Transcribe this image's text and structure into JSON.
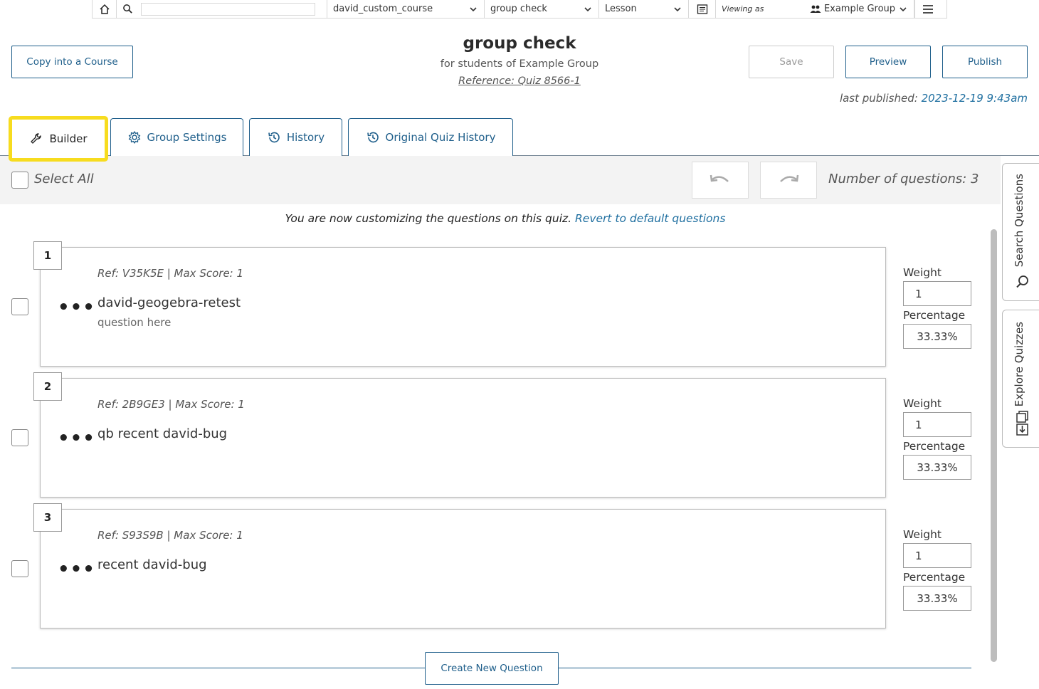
{
  "topbar": {
    "search_placeholder": "",
    "course": "david_custom_course",
    "lesson": "group check",
    "type": "Lesson",
    "viewing_as": "Viewing as",
    "group": "Example Group"
  },
  "header": {
    "title": "group check",
    "subtitle": "for students of Example Group",
    "reference": "Reference: Quiz 8566-1",
    "copy_label": "Copy into a Course",
    "save_label": "Save",
    "preview_label": "Preview",
    "publish_label": "Publish",
    "last_published_label": "last published:",
    "last_published_date": "2023-12-19 9:43am"
  },
  "tabs": [
    {
      "label": "Builder",
      "icon": "wrench-icon"
    },
    {
      "label": "Group Settings",
      "icon": "gear-icon"
    },
    {
      "label": "History",
      "icon": "history-icon"
    },
    {
      "label": "Original Quiz History",
      "icon": "history-icon"
    }
  ],
  "toolbar": {
    "select_all": "Select All",
    "num_questions": "Number of questions: 3"
  },
  "notice": {
    "text": "You are now customizing the questions on this quiz.",
    "link": "Revert to default questions"
  },
  "questions": [
    {
      "num": "1",
      "ref": "Ref:  V35K5E  |  Max Score:  1",
      "title": "david-geogebra-retest",
      "desc": "question here",
      "weight": "1",
      "percentage": "33.33%"
    },
    {
      "num": "2",
      "ref": "Ref:  2B9GE3  |  Max Score:  1",
      "title": "qb recent david-bug",
      "desc": "",
      "weight": "1",
      "percentage": "33.33%"
    },
    {
      "num": "3",
      "ref": "Ref:  S93S9B  |  Max Score:  1",
      "title": "recent david-bug",
      "desc": "",
      "weight": "1",
      "percentage": "33.33%"
    }
  ],
  "labels": {
    "weight": "Weight",
    "percentage": "Percentage",
    "dots": "•••"
  },
  "side": {
    "search": "Search Questions",
    "explore": "Explore Quizzes"
  },
  "footer": {
    "create_label": "Create New Question"
  },
  "colors": {
    "accent": "#1f5f8b",
    "link": "#1f6fa0",
    "highlight": "#f7dc1f"
  }
}
